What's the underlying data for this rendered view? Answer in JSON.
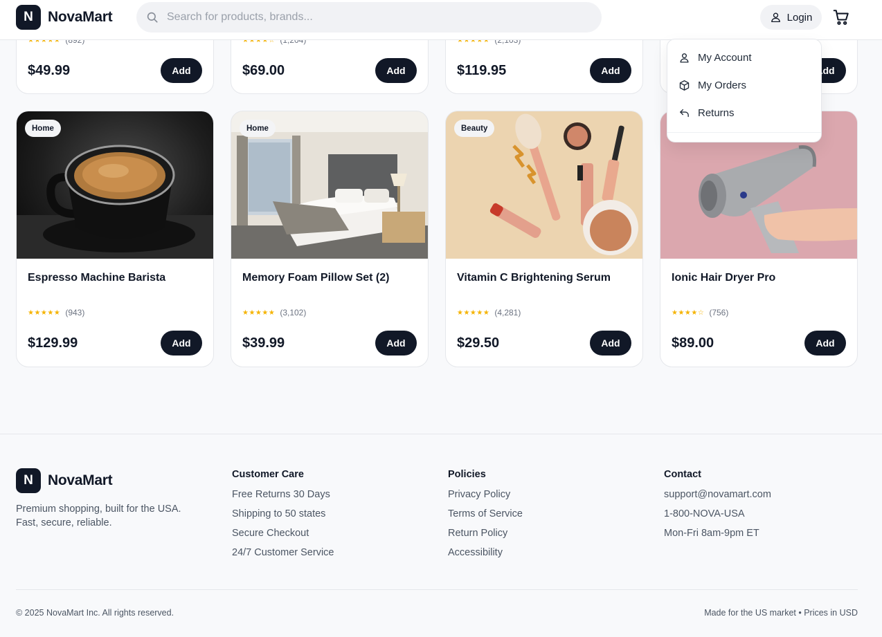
{
  "header": {
    "logo_letter": "N",
    "logo_text": "NovaMart",
    "search_placeholder": "Search for products, brands...",
    "login_label": "Login"
  },
  "account_menu": {
    "items": [
      {
        "label": "My Account",
        "icon": "user-icon"
      },
      {
        "label": "My Orders",
        "icon": "box-icon"
      },
      {
        "label": "Returns",
        "icon": "return-arrow-icon"
      }
    ]
  },
  "top_row": [
    {
      "rating_count": "(892)",
      "price": "$49.99",
      "add_label": "Add"
    },
    {
      "rating_count": "(1,204)",
      "price": "$69.00",
      "add_label": "Add"
    },
    {
      "rating_count": "(2,103)",
      "price": "$119.95",
      "add_label": "Add"
    },
    {
      "rating_count": "",
      "price": "",
      "add_label": "Add"
    }
  ],
  "products": [
    {
      "category": "Home",
      "title": "Espresso Machine Barista",
      "stars": "★★★★★",
      "rating": 5,
      "rating_count": "(943)",
      "price": "$129.99",
      "add_label": "Add"
    },
    {
      "category": "Home",
      "title": "Memory Foam Pillow Set (2)",
      "stars": "★★★★★",
      "rating": 5,
      "rating_count": "(3,102)",
      "price": "$39.99",
      "add_label": "Add"
    },
    {
      "category": "Beauty",
      "title": "Vitamin C Brightening Serum",
      "stars": "★★★★★",
      "rating": 5,
      "rating_count": "(4,281)",
      "price": "$29.50",
      "add_label": "Add"
    },
    {
      "category": "",
      "title": "Ionic Hair Dryer Pro",
      "stars": "★★★★☆",
      "rating": 4,
      "rating_count": "(756)",
      "price": "$89.00",
      "add_label": "Add"
    }
  ],
  "footer": {
    "logo_letter": "N",
    "logo_text": "NovaMart",
    "tagline_1": "Premium shopping, built for the USA.",
    "tagline_2": "Fast, secure, reliable.",
    "columns": [
      {
        "heading": "Customer Care",
        "links": [
          "Free Returns 30 Days",
          "Shipping to 50 states",
          "Secure Checkout",
          "24/7 Customer Service"
        ]
      },
      {
        "heading": "Policies",
        "links": [
          "Privacy Policy",
          "Terms of Service",
          "Return Policy",
          "Accessibility"
        ]
      },
      {
        "heading": "Contact",
        "links": [
          "support@novamart.com",
          "1-800-NOVA-USA",
          "Mon-Fri 8am-9pm ET"
        ]
      }
    ],
    "copyright": "© 2025 NovaMart Inc. All rights reserved.",
    "market_note": "Made for the US market • Prices in USD"
  },
  "colors": {
    "primary": "#111827",
    "star": "#f5b301",
    "surface": "#ffffff",
    "background": "#f8f9fb"
  }
}
